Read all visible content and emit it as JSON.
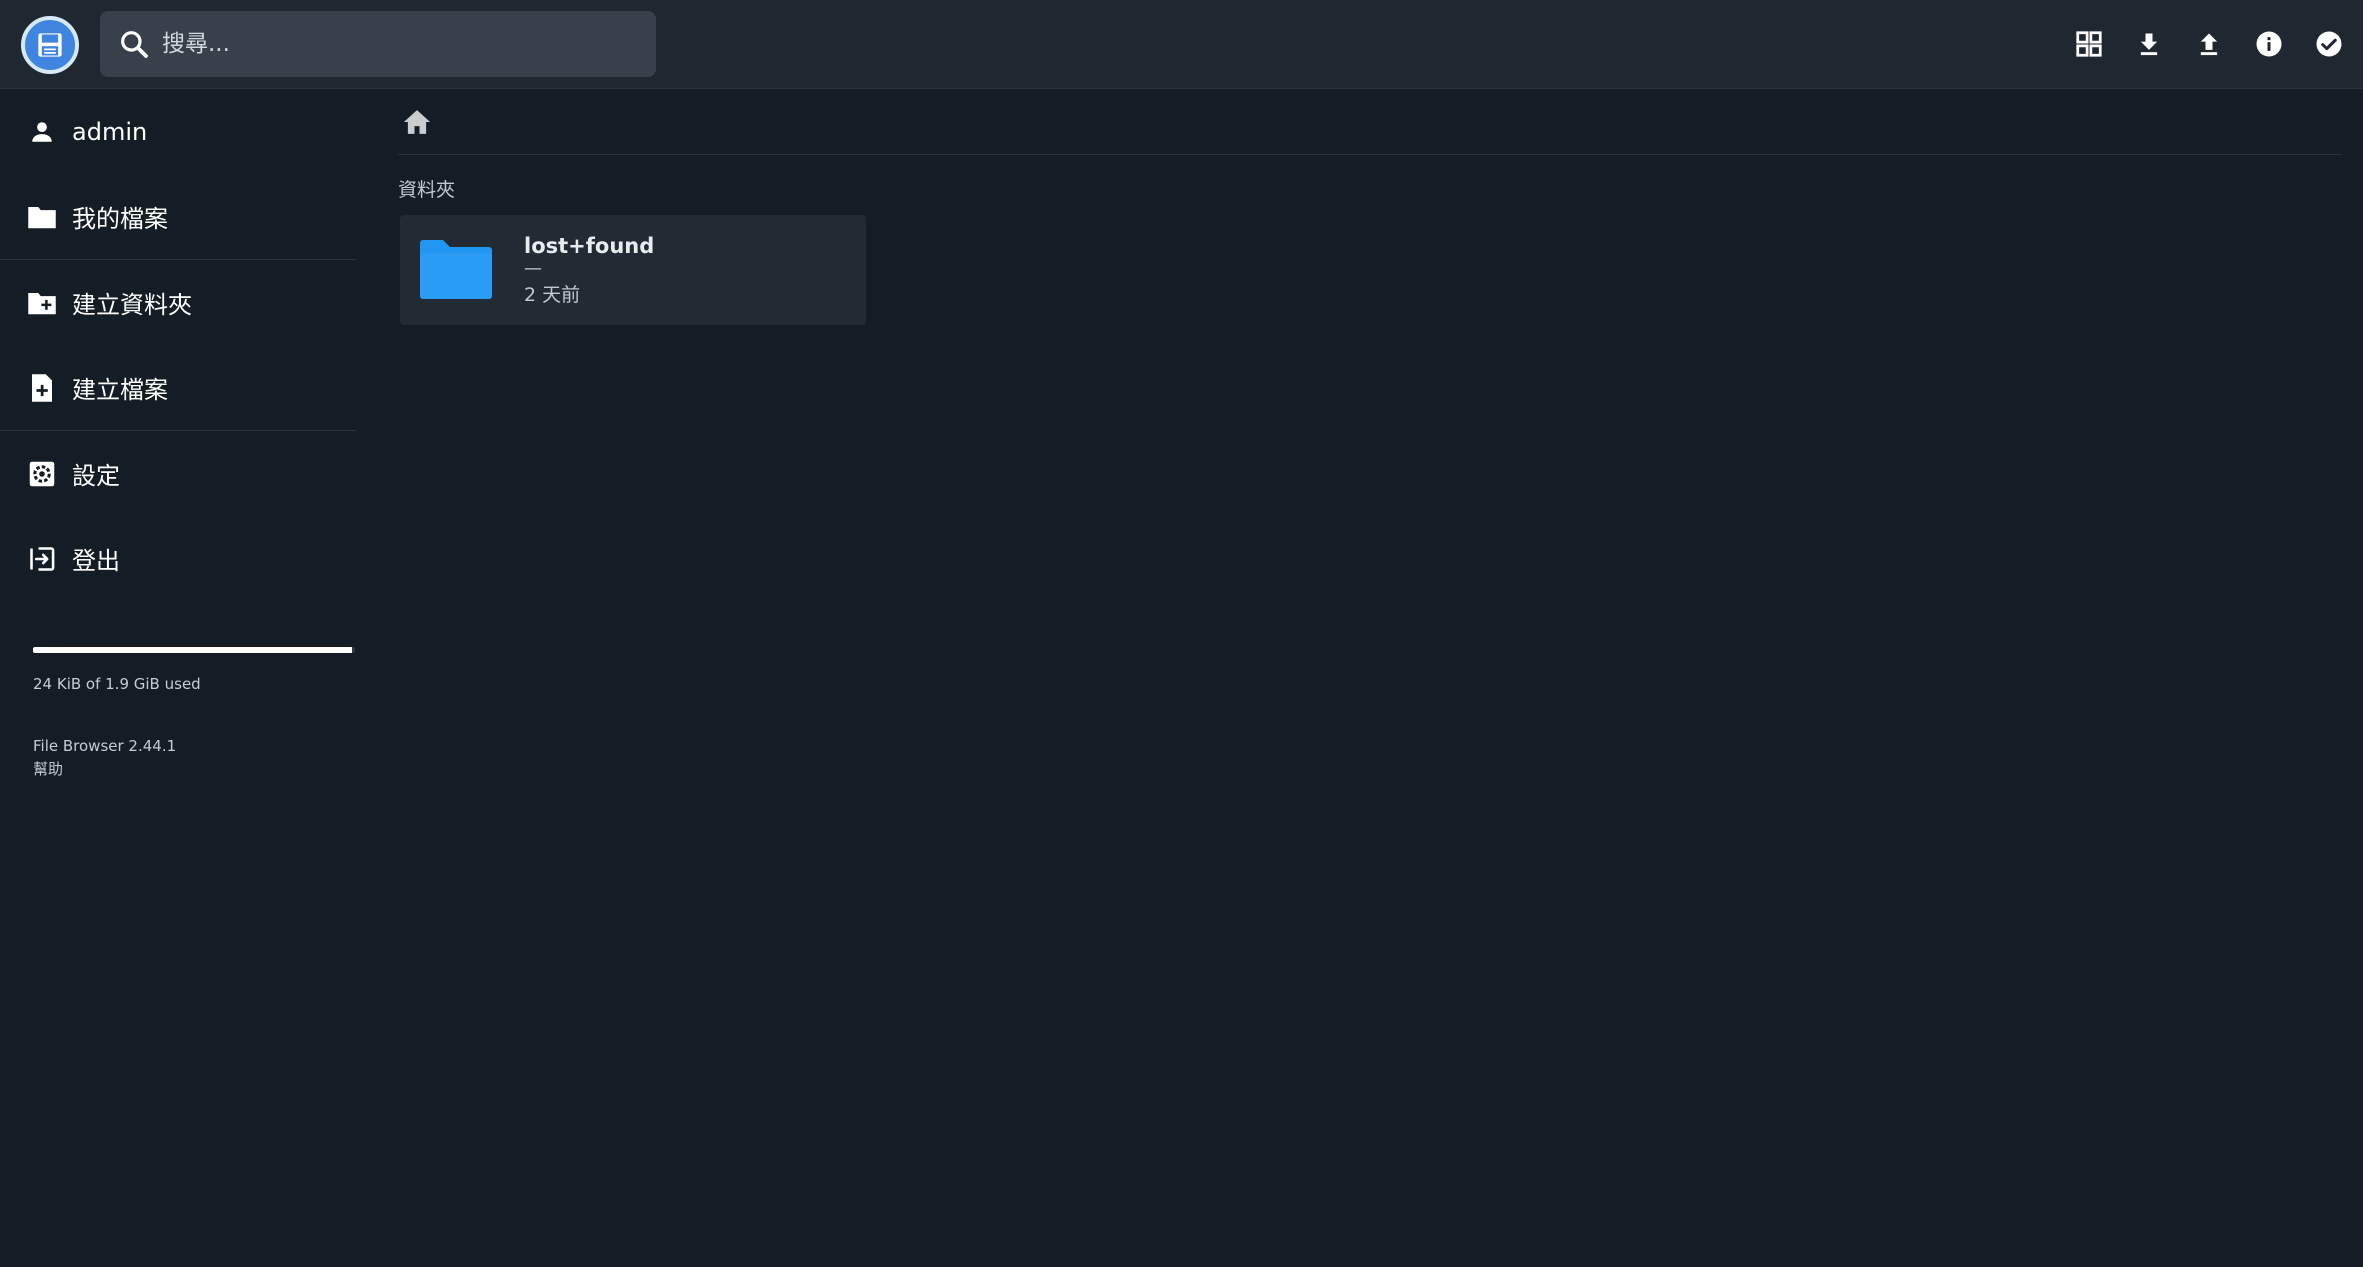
{
  "header": {
    "search_placeholder": "搜尋...",
    "logo_icon": "floppy-disk-icon",
    "toolbar_icons": [
      "grid-view-icon",
      "download-icon",
      "upload-icon",
      "info-icon",
      "check-circle-icon"
    ]
  },
  "sidebar": {
    "user": "admin",
    "items": [
      {
        "label": "我的檔案",
        "icon": "folder-icon"
      },
      {
        "label": "建立資料夾",
        "icon": "folder-plus-icon"
      },
      {
        "label": "建立檔案",
        "icon": "file-plus-icon"
      },
      {
        "label": "設定",
        "icon": "gear-icon"
      },
      {
        "label": "登出",
        "icon": "logout-icon"
      }
    ],
    "storage": {
      "text": "24 KiB of 1.9 GiB used",
      "used_fraction": 0.99
    },
    "version": "File Browser 2.44.1",
    "help": "幫助"
  },
  "main": {
    "breadcrumb_icon": "home-icon",
    "section_title": "資料夾",
    "folders": [
      {
        "name": "lost+found",
        "size": "—",
        "modified": "2 天前"
      }
    ]
  },
  "colors": {
    "background": "#141c25",
    "header": "#1f2731",
    "search": "#37404b",
    "card": "#222a33",
    "folder_accent": "#2196f3"
  }
}
